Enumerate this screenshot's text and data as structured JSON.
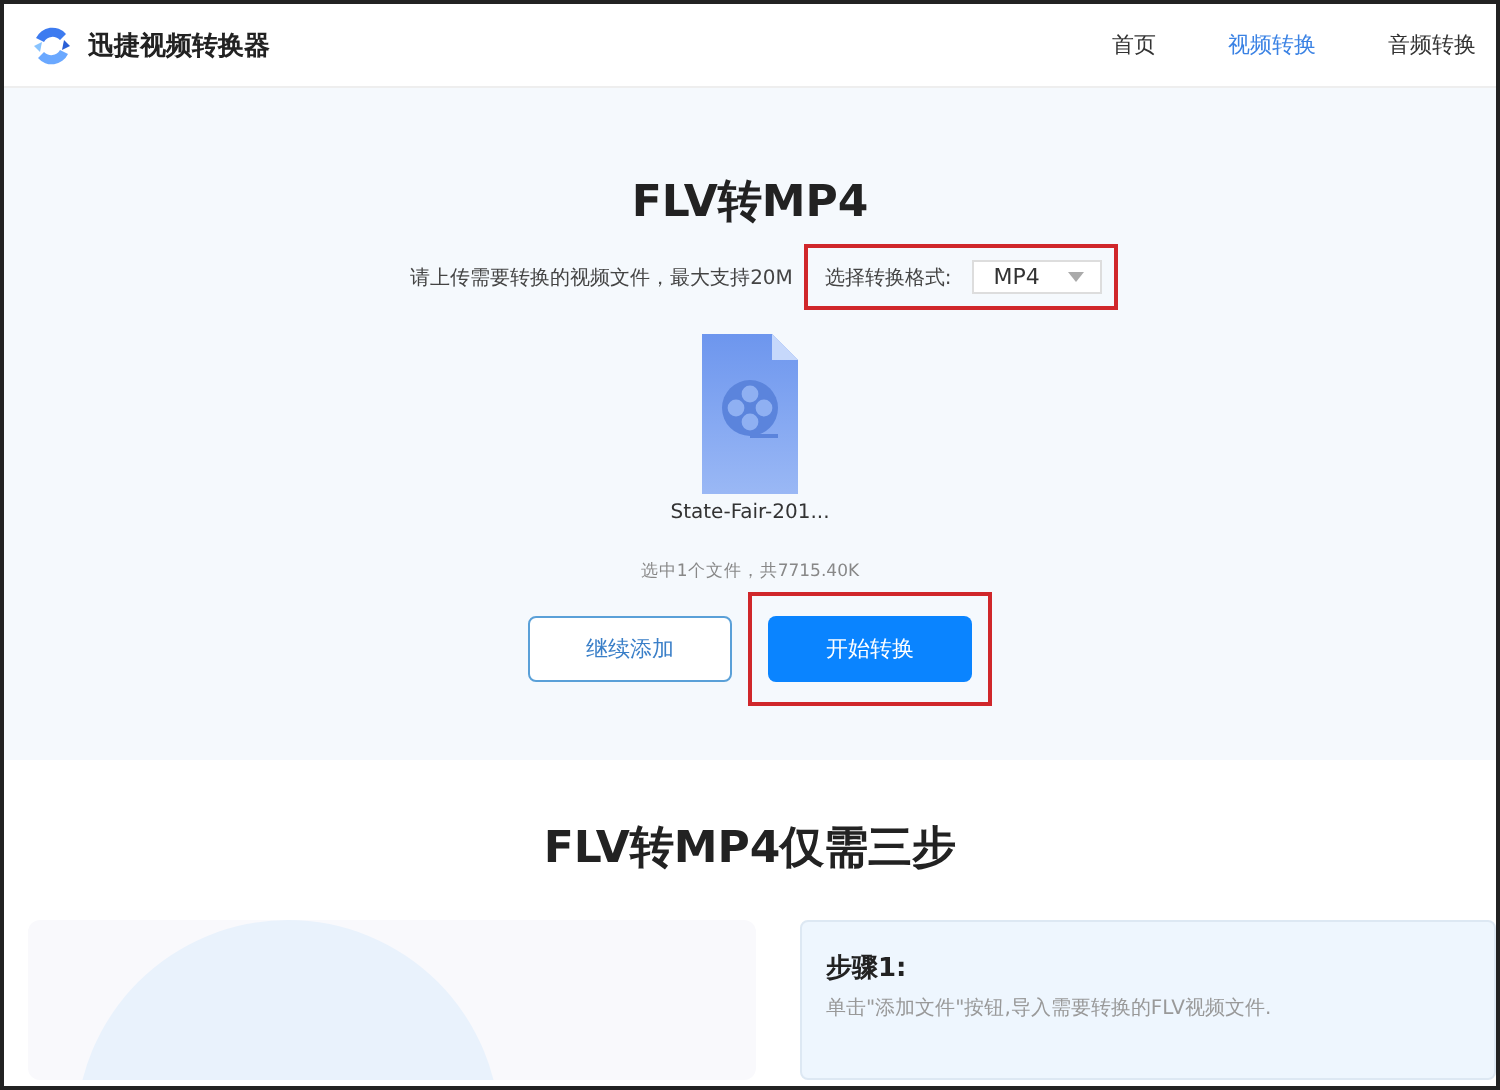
{
  "header": {
    "logo_text": "迅捷视频转换器",
    "nav": [
      {
        "label": "首页",
        "selected": false
      },
      {
        "label": "视频转换",
        "selected": true
      },
      {
        "label": "音频转换",
        "selected": false
      }
    ]
  },
  "converter": {
    "title": "FLV转MP4",
    "upload_hint": "请上传需要转换的视频文件，最大支持20M",
    "format_label": "选择转换格式:",
    "format_value": "MP4",
    "file_name": "State-Fair-201...",
    "summary": "选中1个文件，共7715.40K",
    "buttons": [
      {
        "label": "继续添加",
        "kind": "outline"
      },
      {
        "label": "开始转换",
        "kind": "primary"
      }
    ]
  },
  "steps_section": {
    "title": "FLV转MP4仅需三步",
    "step_title": "步骤1:",
    "step_text": "单击\"添加文件\"按钮,导入需要转换的FLV视频文件."
  }
}
